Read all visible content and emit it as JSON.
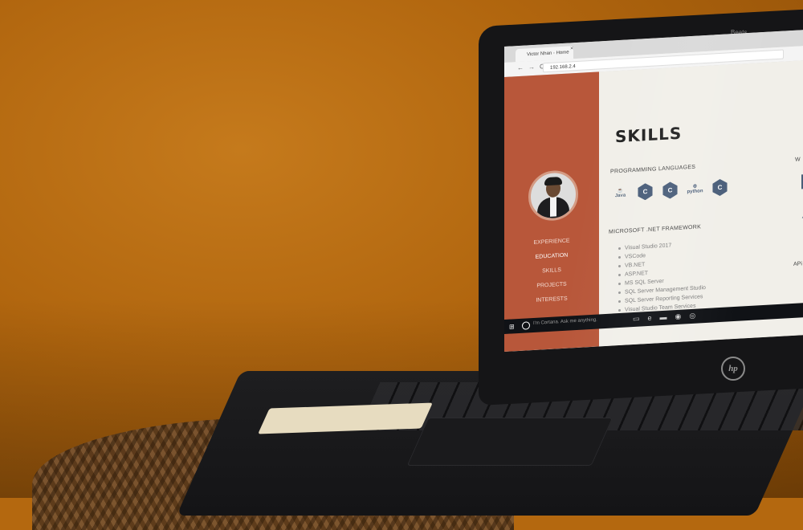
{
  "browser": {
    "tab_title": "Victor Nhan - Home",
    "tab_close": "×",
    "nav_icons": "←→C",
    "url": "192.168.2.4"
  },
  "sidebar": {
    "items": [
      {
        "label": "EXPERIENCE"
      },
      {
        "label": "EDUCATION"
      },
      {
        "label": "SKILLS"
      },
      {
        "label": "PROJECTS"
      },
      {
        "label": "INTERESTS"
      }
    ],
    "active_index": 1
  },
  "main": {
    "title": "SKILLS",
    "section_programming": "PROGRAMMING LANGUAGES",
    "languages": [
      {
        "name": "java-icon",
        "label": "Java"
      },
      {
        "name": "c-icon",
        "label": "C"
      },
      {
        "name": "csharp-icon",
        "label": "C"
      },
      {
        "name": "python-icon",
        "label": "python"
      },
      {
        "name": "cpp-icon",
        "label": "C"
      }
    ],
    "section_dotnet": "MICROSOFT .NET FRAMEWORK",
    "dotnet_items": [
      "Visual Studio 2017",
      "VSCode",
      "VB.NET",
      "ASP.NET",
      "MS SQL Server",
      "SQL Server Management Studio",
      "SQL Server Reporting Services",
      "Visual Studio Team Services"
    ],
    "section_right_top": "W",
    "section_right_bottom": "APi"
  },
  "taskbar": {
    "start_icon": "⊞",
    "search_placeholder": "I'm Cortana. Ask me anything."
  },
  "laptop": {
    "bezel_brand": "Beats",
    "logo": "hp"
  },
  "colors": {
    "wall": "#b4680f",
    "sidebar": "#b8573a",
    "page_bg": "#f1efe9",
    "icon_accent": "#4a5e7a"
  }
}
